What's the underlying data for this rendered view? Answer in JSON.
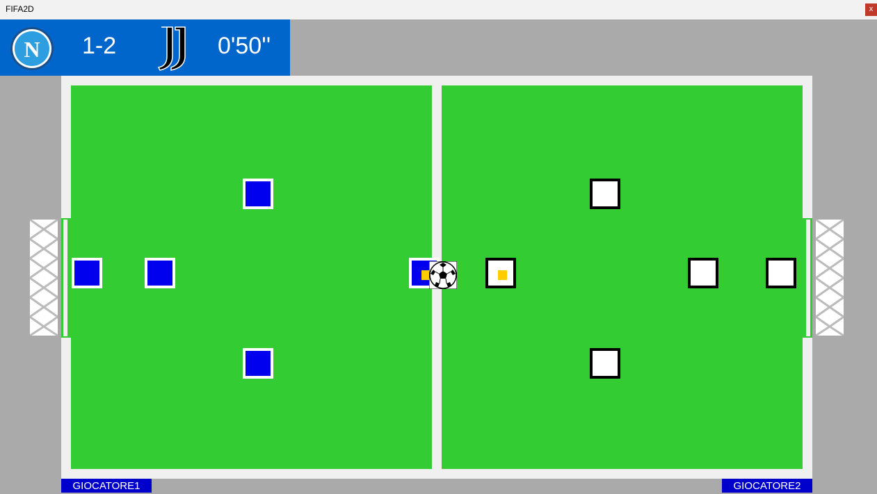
{
  "window": {
    "title": "FIFA2D",
    "close_label": "x"
  },
  "scoreboard": {
    "home_team_logo": "napoli-logo",
    "home_logo_letter": "N",
    "score": "1-2",
    "away_team_logo": "juventus-logo",
    "time": "0'50''"
  },
  "field": {
    "grass_color": "#33cc33",
    "line_color": "#f0f0f0",
    "home_team_color": "#0000ee",
    "away_team_color": "#ffffff",
    "controlled_marker_color": "#ffcc00"
  },
  "players": {
    "player1_label": "GIOCATORE1",
    "player2_label": "GIOCATORE2"
  }
}
